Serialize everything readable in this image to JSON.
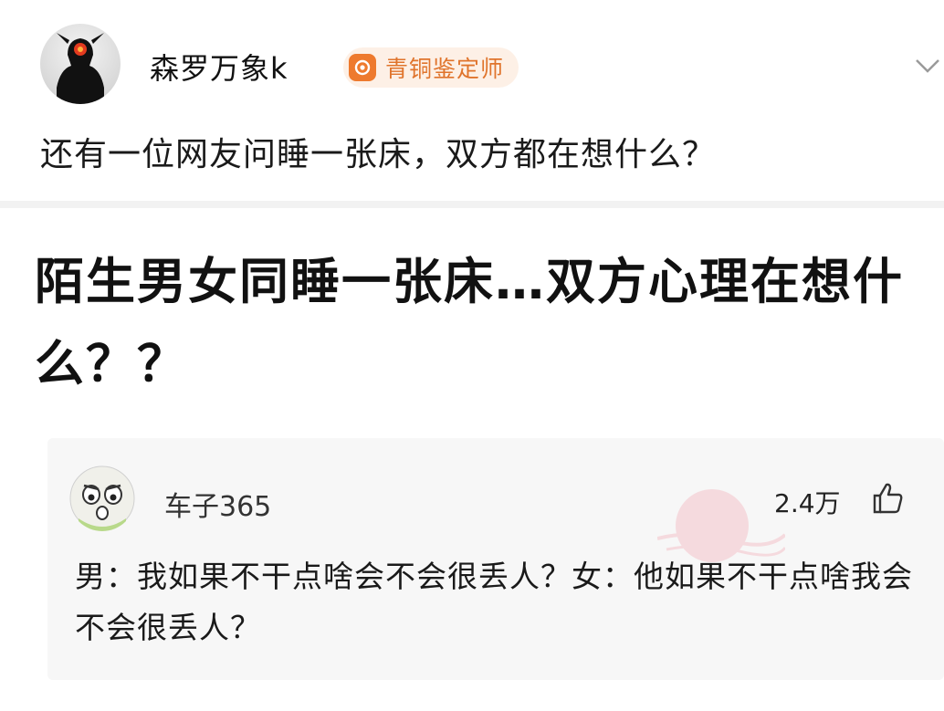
{
  "post": {
    "author": "森罗万象k",
    "badge": "青铜鉴定师",
    "text": "还有一位网友问睡一张床，双方都在想什么？"
  },
  "card": {
    "headline": "陌生男女同睡一张床…双方心理在想什么？？"
  },
  "comment": {
    "user": "车子365",
    "likes": "2.4万",
    "text": "男：我如果不干点啥会不会很丢人？女：他如果不干点啥我会不会很丢人？"
  },
  "icons": {
    "avatar": "warrior-silhouette-avatar",
    "badge": "bronze-badge-icon",
    "more": "chevron-down-icon",
    "comment_avatar": "cartoon-face-avatar",
    "like": "thumbs-up-icon",
    "watermark": "shenping-watermark"
  },
  "colors": {
    "badge_bg": "#fdf0e6",
    "badge_accent": "#ee7a2e",
    "comment_bg": "#f7f7f7"
  }
}
